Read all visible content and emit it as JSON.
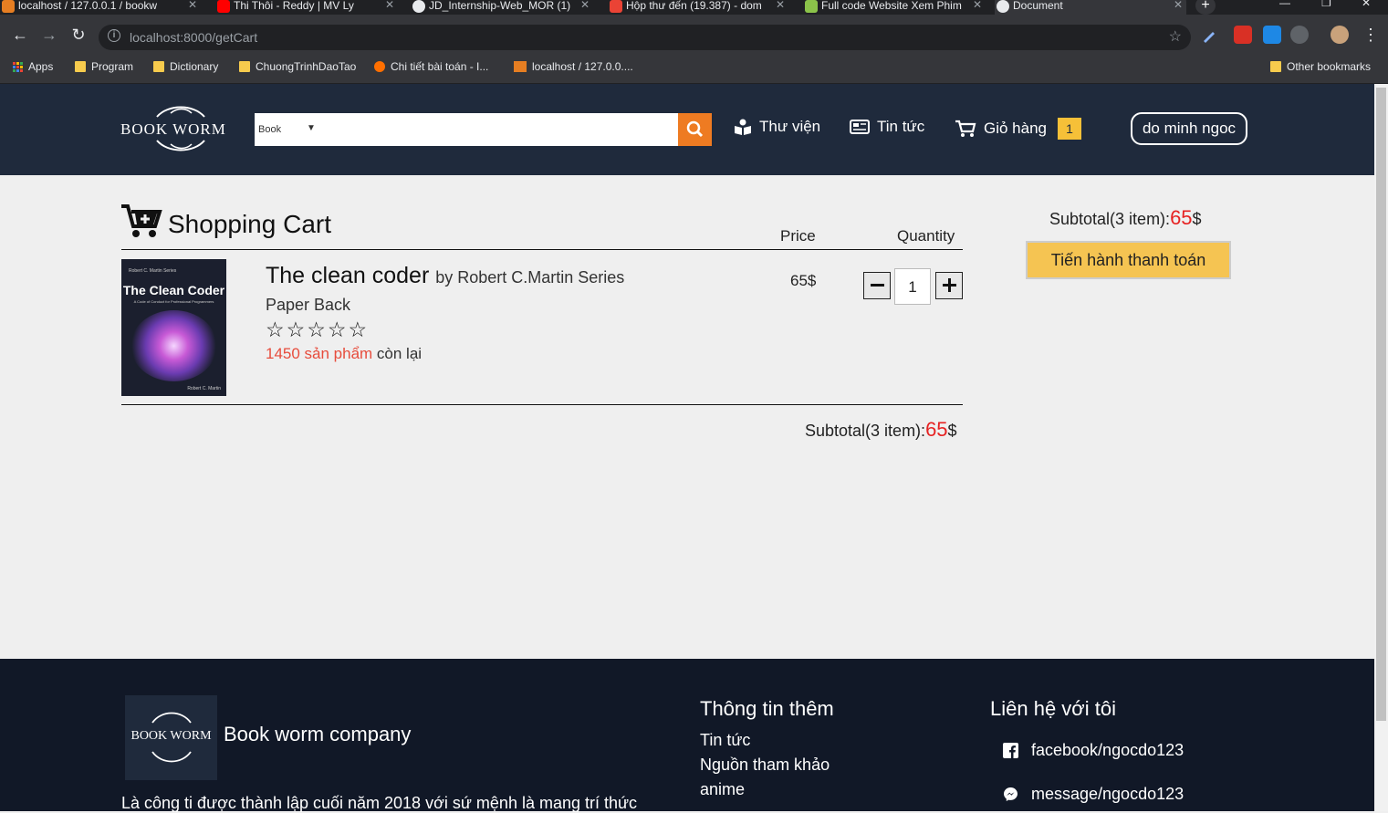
{
  "browser": {
    "tabs": [
      {
        "title": "localhost / 127.0.0.1 / bookw",
        "color": "#e67e22"
      },
      {
        "title": "Thi Thôi - Reddy | MV Ly",
        "color": "#ff0000"
      },
      {
        "title": "JD_Internship-Web_MOR (1)",
        "color": "#e8eaed"
      },
      {
        "title": "Hộp thư đến (19.387) - dom",
        "color": "#ea4335"
      },
      {
        "title": "Full code Website Xem Phim",
        "color": "#8bc34a"
      },
      {
        "title": "Document",
        "color": "#e8eaed"
      }
    ],
    "url": "localhost:8000/getCart",
    "bookmarks": [
      {
        "label": "Apps"
      },
      {
        "label": "Program"
      },
      {
        "label": "Dictionary"
      },
      {
        "label": "ChuongTrinhDaoTao"
      },
      {
        "label": "Chi tiết bài toán - I..."
      },
      {
        "label": "localhost / 127.0.0...."
      }
    ],
    "other_bookmarks": "Other bookmarks"
  },
  "header": {
    "logo_text": "BOOK WORM",
    "search_category": "Book",
    "search_placeholder": "",
    "nav": [
      {
        "label": "Thư viện",
        "icon": "reader-icon"
      },
      {
        "label": "Tin tức",
        "icon": "newspaper-icon"
      },
      {
        "label": "Giỏ hàng",
        "icon": "cart-icon"
      }
    ],
    "cart_count": "1",
    "user": "do minh ngoc"
  },
  "cart": {
    "title": "Shopping Cart",
    "col_price": "Price",
    "col_quantity": "Quantity",
    "item": {
      "title": "The clean coder",
      "author": "by Robert C.Martin Series",
      "format": "Paper Back",
      "rating": 0,
      "stars": "☆☆☆☆☆",
      "stock_count": "1450 sản phẩm",
      "stock_suffix": " còn lại",
      "price": "65$",
      "quantity": "1",
      "cover": {
        "series": "Robert C. Martin Series",
        "title": "The Clean Coder",
        "subtitle": "A Code of Conduct for Professional Programmers",
        "author": "Robert C. Martin"
      }
    },
    "subtotal_label": "Subtotal(3 item):",
    "subtotal_value": "65",
    "currency": "$",
    "checkout_label": "Tiến hành thanh toán"
  },
  "footer": {
    "logo_text": "BOOK WORM",
    "company": "Book worm company",
    "description": "Là công ti được thành lập cuối năm 2018 với sứ mệnh là mang trí thức",
    "info_title": "Thông tin thêm",
    "info_links": [
      "Tin tức",
      "Nguồn tham khảo",
      "anime"
    ],
    "contact_title": "Liên hệ với tôi",
    "contacts": [
      {
        "label": "facebook/ngocdo123",
        "icon": "facebook-icon"
      },
      {
        "label": "message/ngocdo123",
        "icon": "messenger-icon"
      }
    ]
  },
  "colors": {
    "header_bg": "#1f2a3c",
    "search_button": "#ee7b22",
    "badge": "#f6c038",
    "checkout": "#f5c452",
    "price_red": "#e62222",
    "footer_bg": "#111827"
  }
}
